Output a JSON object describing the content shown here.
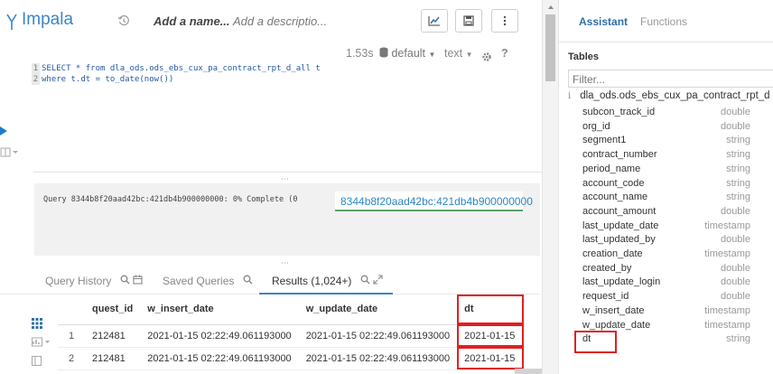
{
  "app": {
    "title": "Impala",
    "add_name_placeholder": "Add a name...",
    "add_desc_placeholder": "Add a descriptio..."
  },
  "toolbar": {
    "duration": "1.53s",
    "database": "default",
    "format": "text",
    "help": "?"
  },
  "editor": {
    "lines": [
      {
        "num": "1",
        "text": "SELECT * from dla_ods.ods_ebs_cux_pa_contract_rpt_d_all t"
      },
      {
        "num": "2",
        "text": "where t.dt = to_date(now())"
      }
    ]
  },
  "log": {
    "text": "Query 8344b8f20aad42bc:421db4b900000000: 0% Complete (0",
    "tooltip": "8344b8f20aad42bc:421db4b900000000"
  },
  "tabs": {
    "history": "Query History",
    "saved": "Saved Queries",
    "results": "Results (1,024+)"
  },
  "results": {
    "columns": [
      "quest_id",
      "w_insert_date",
      "w_update_date",
      "dt"
    ],
    "rows": [
      {
        "num": "1",
        "cells": [
          "212481",
          "2021-01-15 02:22:49.061193000",
          "2021-01-15 02:22:49.061193000",
          "2021-01-15"
        ]
      },
      {
        "num": "2",
        "cells": [
          "212481",
          "2021-01-15 02:22:49.061193000",
          "2021-01-15 02:22:49.061193000",
          "2021-01-15"
        ]
      }
    ]
  },
  "assistant": {
    "tab_assistant": "Assistant",
    "tab_functions": "Functions",
    "section": "Tables",
    "filter_placeholder": "Filter...",
    "table_name": "dla_ods.ods_ebs_cux_pa_contract_rpt_d",
    "columns": [
      {
        "name": "subcon_track_id",
        "type": "double"
      },
      {
        "name": "org_id",
        "type": "double"
      },
      {
        "name": "segment1",
        "type": "string"
      },
      {
        "name": "contract_number",
        "type": "string"
      },
      {
        "name": "period_name",
        "type": "string"
      },
      {
        "name": "account_code",
        "type": "string"
      },
      {
        "name": "account_name",
        "type": "string"
      },
      {
        "name": "account_amount",
        "type": "double"
      },
      {
        "name": "last_update_date",
        "type": "timestamp"
      },
      {
        "name": "last_updated_by",
        "type": "double"
      },
      {
        "name": "creation_date",
        "type": "timestamp"
      },
      {
        "name": "created_by",
        "type": "double"
      },
      {
        "name": "last_update_login",
        "type": "double"
      },
      {
        "name": "request_id",
        "type": "double"
      },
      {
        "name": "w_insert_date",
        "type": "timestamp"
      },
      {
        "name": "w_update_date",
        "type": "timestamp"
      },
      {
        "name": "dt",
        "type": "string"
      }
    ]
  },
  "colors": {
    "accent": "#3a85c6",
    "highlight": "#e02020",
    "success_line": "#5aa36a"
  }
}
